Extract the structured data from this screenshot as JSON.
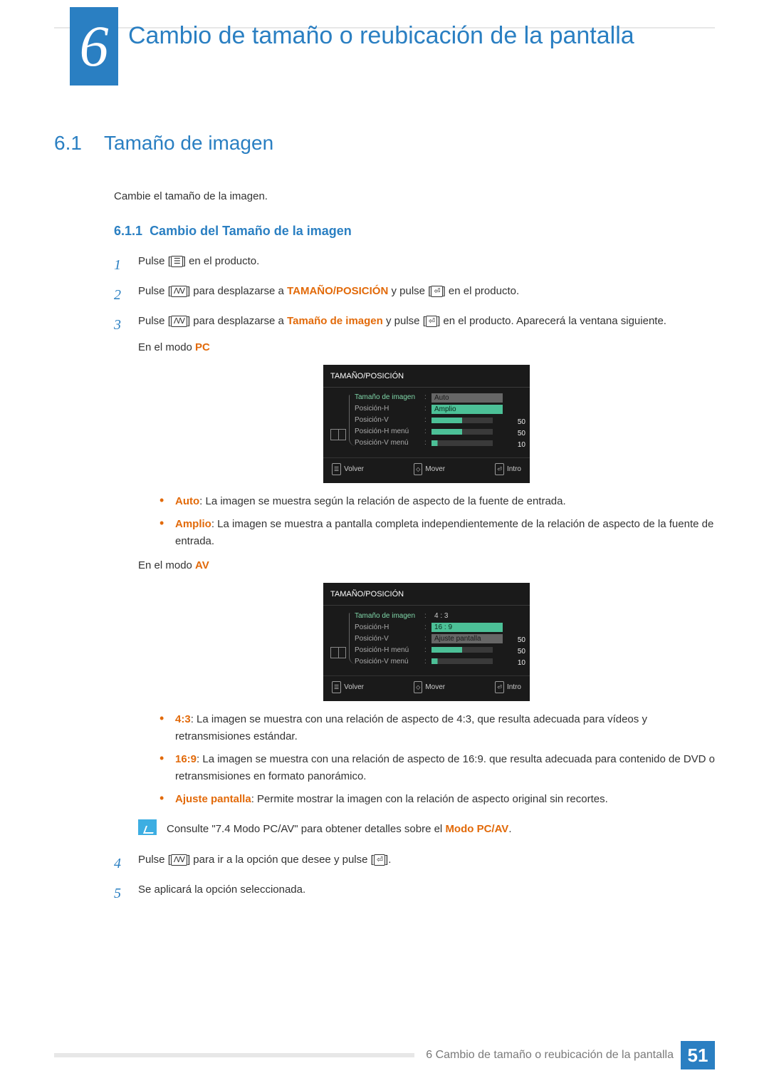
{
  "chapter": {
    "number": "6",
    "title": "Cambio de tamaño o reubicación de la pantalla"
  },
  "section": {
    "number": "6.1",
    "title": "Tamaño de imagen"
  },
  "intro": "Cambie el tamaño de la imagen.",
  "subsection": {
    "number": "6.1.1",
    "title": "Cambio del Tamaño de la imagen"
  },
  "steps": {
    "s1": {
      "num": "1",
      "pre": "Pulse [",
      "post": "] en el producto."
    },
    "s2": {
      "num": "2",
      "pre": "Pulse [",
      "mid1": "] para desplazarse a ",
      "tgt": "TAMAÑO/POSICIÓN",
      "mid2": " y pulse [",
      "post": "] en el producto."
    },
    "s3": {
      "num": "3",
      "pre": "Pulse [",
      "mid1": "] para desplazarse a ",
      "tgt": "Tamaño de imagen",
      "mid2": " y pulse [",
      "post": "] en el producto. Aparecerá la ventana siguiente."
    },
    "mode_pc_pre": "En el modo ",
    "mode_pc": "PC",
    "mode_av_pre": "En el modo ",
    "mode_av": "AV",
    "s4": {
      "num": "4",
      "pre": "Pulse [",
      "mid": "] para ir a la opción que desee y pulse [",
      "post": "]."
    },
    "s5": {
      "num": "5",
      "text": "Se aplicará la opción seleccionada."
    }
  },
  "osd_pc": {
    "title": "TAMAÑO/POSICIÓN",
    "rows": {
      "r0": "Tamaño de imagen",
      "r1": "Posición-H",
      "r2": "Posición-V",
      "r3": "Posición-H menú",
      "r4": "Posición-V menú"
    },
    "opts": {
      "o0": "Auto",
      "o1": "Amplio"
    },
    "vals": {
      "v2": "50",
      "v3": "50",
      "v4": "10"
    },
    "foot": {
      "back": "Volver",
      "move": "Mover",
      "enter": "Intro"
    }
  },
  "osd_av": {
    "title": "TAMAÑO/POSICIÓN",
    "rows": {
      "r0": "Tamaño de imagen",
      "r1": "Posición-H",
      "r2": "Posición-V",
      "r3": "Posición-H menú",
      "r4": "Posición-V menú"
    },
    "opts": {
      "o0": "4 : 3",
      "o1": "16 : 9",
      "o2": "Ajuste pantalla"
    },
    "vals": {
      "v2": "50",
      "v3": "50",
      "v4": "10"
    },
    "foot": {
      "back": "Volver",
      "move": "Mover",
      "enter": "Intro"
    }
  },
  "bullets_pc": {
    "b0t": "Auto",
    "b0": ": La imagen se muestra según la relación de aspecto de la fuente de entrada.",
    "b1t": "Amplio",
    "b1": ": La imagen se muestra a pantalla completa independientemente de la relación de aspecto de la fuente de entrada."
  },
  "bullets_av": {
    "b0t": "4:3",
    "b0": ": La imagen se muestra con una relación de aspecto de 4:3, que resulta adecuada para vídeos y retransmisiones estándar.",
    "b1t": "16:9",
    "b1": ": La imagen se muestra con una relación de aspecto de 16:9. que resulta adecuada para contenido de DVD o retransmisiones en formato panorámico.",
    "b2t": "Ajuste pantalla",
    "b2": ": Permite mostrar la imagen con la relación de aspecto original sin recortes."
  },
  "note": {
    "pre": "Consulte \"7.4 Modo PC/AV\" para obtener detalles sobre el ",
    "link": "Modo PC/AV",
    "post": "."
  },
  "footer": {
    "text": "6 Cambio de tamaño o reubicación de la pantalla",
    "page": "51"
  }
}
